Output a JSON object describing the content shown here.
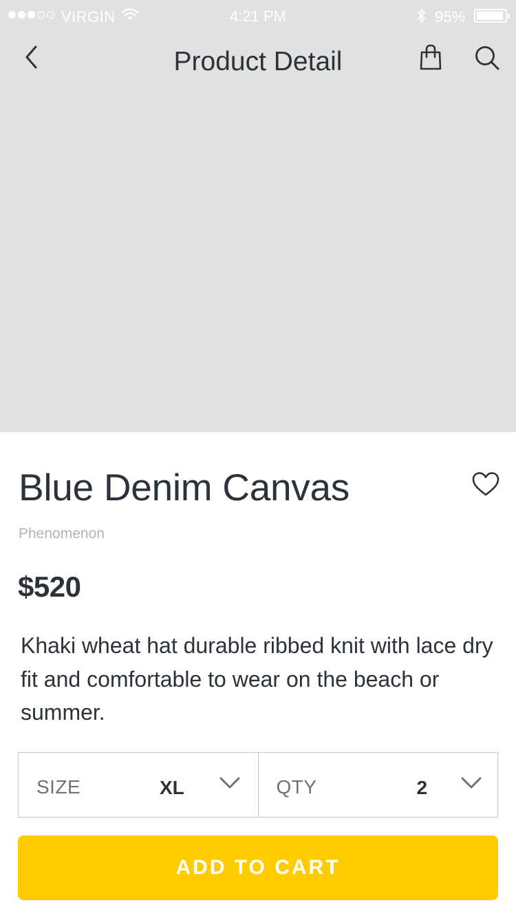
{
  "status_bar": {
    "carrier": "VIRGIN",
    "time": "4:21 PM",
    "battery_pct": "95%",
    "signal_bars_filled": 3,
    "signal_bars_total": 5,
    "battery_level": 0.95
  },
  "nav": {
    "title": "Product Detail",
    "back_icon": "chevron-left-icon",
    "bag_icon": "shopping-bag-icon",
    "search_icon": "search-icon"
  },
  "product": {
    "name": "Blue Denim Canvas",
    "brand": "Phenomenon",
    "price": "$520",
    "description": "Khaki wheat hat durable ribbed knit with lace dry fit and comfortable to wear on the beach or summer."
  },
  "options": {
    "size": {
      "label": "SIZE",
      "value": "XL"
    },
    "qty": {
      "label": "QTY",
      "value": "2"
    }
  },
  "cta": {
    "label": "ADD TO CART"
  },
  "colors": {
    "hero_bg": "#e1e1e1",
    "text_primary": "#2b323a",
    "text_muted": "#b3b3b3",
    "accent": "#ffcc00",
    "border": "#c8c8c8"
  }
}
